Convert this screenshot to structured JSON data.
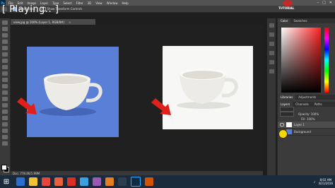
{
  "overlay": {
    "status": "[ Playing.. ]"
  },
  "menubar": {
    "logo": "Ps",
    "items": [
      "File",
      "Edit",
      "Image",
      "Layer",
      "Type",
      "Select",
      "Filter",
      "3D",
      "View",
      "Window",
      "Help"
    ]
  },
  "optionsbar": {
    "checkbox1_label": "Auto-Select:",
    "checkbox2_label": "Show Transform Controls"
  },
  "channel": {
    "name": "TUTORIAL"
  },
  "document": {
    "tab_label": "view.jpg @ 100% (Layer 1, RGB/8#)",
    "status": "Doc: 778.4K/1.99M"
  },
  "panels": {
    "color_tabs": [
      "Color",
      "Swatches"
    ],
    "mid_tabs": [
      "Libraries",
      "Adjustments"
    ],
    "layers_tabs": [
      "Layers",
      "Channels",
      "Paths"
    ],
    "opacity_label": "Opacity: 100%",
    "fill_label": "Fill: 100%",
    "layers": [
      {
        "name": "Layer 1"
      },
      {
        "name": "Background"
      }
    ]
  },
  "taskbar": {
    "time": "8:02 AM",
    "date": "4/21/2016"
  },
  "colors": {
    "left_bg": "#5a7fd6",
    "right_bg": "#f7f7f5",
    "arrow": "#e0201a"
  }
}
